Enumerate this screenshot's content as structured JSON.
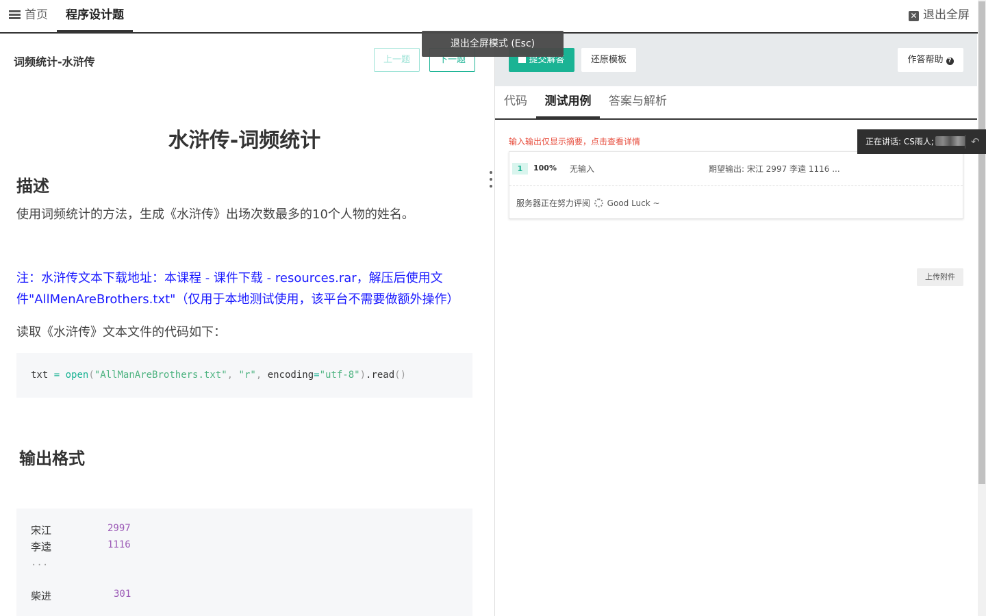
{
  "topbar": {
    "home_label": "首页",
    "problem_tab_label": "程序设计题",
    "exit_fullscreen_label": "退出全屏"
  },
  "tooltip": {
    "text": "退出全屏模式 (Esc)"
  },
  "left": {
    "problem_title": "词频统计-水浒传",
    "prev_label": "上一题",
    "next_label": "下一题",
    "main_title": "水浒传-词频统计",
    "desc_heading": "描述",
    "desc_text": "使用词频统计的方法，生成《水浒传》出场次数最多的10个人物的姓名。",
    "note_text": "注：水浒传文本下载地址：本课程 - 课件下载 - resources.rar，解压后使用文件\"AllMenAreBrothers.txt\"（仅用于本地测试使用，该平台不需要做额外操作）",
    "read_text": "读取《水浒传》文本文件的代码如下：",
    "code": {
      "var": "txt",
      "op": "=",
      "fn": "open",
      "lparen": "(",
      "arg1": "\"AllManAreBrothers.txt\"",
      "comma1": ",",
      "arg2": "\"r\"",
      "comma2": ",",
      "kw": "encoding",
      "eq": "=",
      "arg3": "\"utf-8\"",
      "rparen": ")",
      "method": ".read",
      "parens": "()"
    },
    "output_heading": "输出格式",
    "output_rows": [
      {
        "name": "宋江",
        "count": "2997"
      },
      {
        "name": "李逵",
        "count": "1116"
      },
      {
        "dots": "..."
      },
      {
        "name": "柴进",
        "count": "301"
      }
    ]
  },
  "right": {
    "submit_label": "提交解答",
    "restore_label": "还原模板",
    "help_label": "作答帮助",
    "tabs": [
      "代码",
      "测试用例",
      "答案与解析"
    ],
    "io_hint": "输入输出仅显示摘要，点击查看详情",
    "case": {
      "num": "1",
      "percent": "100%",
      "input": "无输入",
      "expected": "期望输出: 宋江 2997 李逵 1116 ..."
    },
    "status_prefix": "服务器正在努力评阅",
    "status_suffix": "Good Luck ~",
    "upload_label": "上传附件"
  },
  "speaker": {
    "label": "正在讲话: CS雨人;"
  },
  "colors": {
    "accent": "#1ab394",
    "note": "#1a1aff",
    "hint": "#e74c3c"
  },
  "icons": [
    "list-icon",
    "close-icon",
    "save-icon",
    "help-icon",
    "spinner-icon",
    "reply-icon"
  ]
}
